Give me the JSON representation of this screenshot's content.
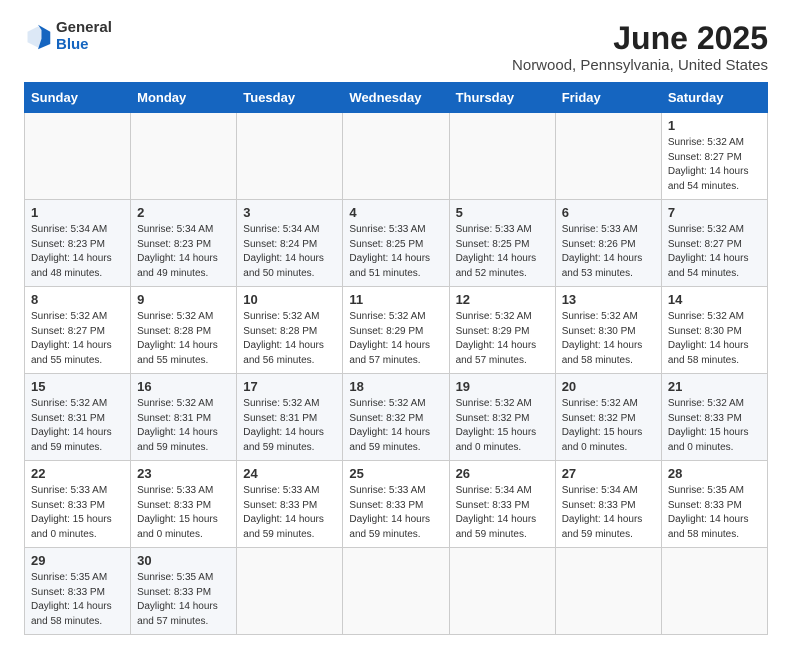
{
  "header": {
    "logo_general": "General",
    "logo_blue": "Blue",
    "month_title": "June 2025",
    "location": "Norwood, Pennsylvania, United States"
  },
  "calendar": {
    "days_of_week": [
      "Sunday",
      "Monday",
      "Tuesday",
      "Wednesday",
      "Thursday",
      "Friday",
      "Saturday"
    ],
    "weeks": [
      [
        {
          "day": "",
          "empty": true
        },
        {
          "day": "",
          "empty": true
        },
        {
          "day": "",
          "empty": true
        },
        {
          "day": "",
          "empty": true
        },
        {
          "day": "",
          "empty": true
        },
        {
          "day": "",
          "empty": true
        },
        {
          "day": "1",
          "sunrise": "5:32 AM",
          "sunset": "8:27 PM",
          "daylight": "14 hours and 54 minutes."
        }
      ],
      [
        {
          "day": "1",
          "sunrise": "5:34 AM",
          "sunset": "8:23 PM",
          "daylight": "14 hours and 48 minutes."
        },
        {
          "day": "2",
          "sunrise": "5:34 AM",
          "sunset": "8:23 PM",
          "daylight": "14 hours and 49 minutes."
        },
        {
          "day": "3",
          "sunrise": "5:34 AM",
          "sunset": "8:24 PM",
          "daylight": "14 hours and 50 minutes."
        },
        {
          "day": "4",
          "sunrise": "5:33 AM",
          "sunset": "8:25 PM",
          "daylight": "14 hours and 51 minutes."
        },
        {
          "day": "5",
          "sunrise": "5:33 AM",
          "sunset": "8:25 PM",
          "daylight": "14 hours and 52 minutes."
        },
        {
          "day": "6",
          "sunrise": "5:33 AM",
          "sunset": "8:26 PM",
          "daylight": "14 hours and 53 minutes."
        },
        {
          "day": "7",
          "sunrise": "5:32 AM",
          "sunset": "8:27 PM",
          "daylight": "14 hours and 54 minutes."
        }
      ],
      [
        {
          "day": "8",
          "sunrise": "5:32 AM",
          "sunset": "8:27 PM",
          "daylight": "14 hours and 55 minutes."
        },
        {
          "day": "9",
          "sunrise": "5:32 AM",
          "sunset": "8:28 PM",
          "daylight": "14 hours and 55 minutes."
        },
        {
          "day": "10",
          "sunrise": "5:32 AM",
          "sunset": "8:28 PM",
          "daylight": "14 hours and 56 minutes."
        },
        {
          "day": "11",
          "sunrise": "5:32 AM",
          "sunset": "8:29 PM",
          "daylight": "14 hours and 57 minutes."
        },
        {
          "day": "12",
          "sunrise": "5:32 AM",
          "sunset": "8:29 PM",
          "daylight": "14 hours and 57 minutes."
        },
        {
          "day": "13",
          "sunrise": "5:32 AM",
          "sunset": "8:30 PM",
          "daylight": "14 hours and 58 minutes."
        },
        {
          "day": "14",
          "sunrise": "5:32 AM",
          "sunset": "8:30 PM",
          "daylight": "14 hours and 58 minutes."
        }
      ],
      [
        {
          "day": "15",
          "sunrise": "5:32 AM",
          "sunset": "8:31 PM",
          "daylight": "14 hours and 59 minutes."
        },
        {
          "day": "16",
          "sunrise": "5:32 AM",
          "sunset": "8:31 PM",
          "daylight": "14 hours and 59 minutes."
        },
        {
          "day": "17",
          "sunrise": "5:32 AM",
          "sunset": "8:31 PM",
          "daylight": "14 hours and 59 minutes."
        },
        {
          "day": "18",
          "sunrise": "5:32 AM",
          "sunset": "8:32 PM",
          "daylight": "14 hours and 59 minutes."
        },
        {
          "day": "19",
          "sunrise": "5:32 AM",
          "sunset": "8:32 PM",
          "daylight": "15 hours and 0 minutes."
        },
        {
          "day": "20",
          "sunrise": "5:32 AM",
          "sunset": "8:32 PM",
          "daylight": "15 hours and 0 minutes."
        },
        {
          "day": "21",
          "sunrise": "5:32 AM",
          "sunset": "8:33 PM",
          "daylight": "15 hours and 0 minutes."
        }
      ],
      [
        {
          "day": "22",
          "sunrise": "5:33 AM",
          "sunset": "8:33 PM",
          "daylight": "15 hours and 0 minutes."
        },
        {
          "day": "23",
          "sunrise": "5:33 AM",
          "sunset": "8:33 PM",
          "daylight": "15 hours and 0 minutes."
        },
        {
          "day": "24",
          "sunrise": "5:33 AM",
          "sunset": "8:33 PM",
          "daylight": "14 hours and 59 minutes."
        },
        {
          "day": "25",
          "sunrise": "5:33 AM",
          "sunset": "8:33 PM",
          "daylight": "14 hours and 59 minutes."
        },
        {
          "day": "26",
          "sunrise": "5:34 AM",
          "sunset": "8:33 PM",
          "daylight": "14 hours and 59 minutes."
        },
        {
          "day": "27",
          "sunrise": "5:34 AM",
          "sunset": "8:33 PM",
          "daylight": "14 hours and 59 minutes."
        },
        {
          "day": "28",
          "sunrise": "5:35 AM",
          "sunset": "8:33 PM",
          "daylight": "14 hours and 58 minutes."
        }
      ],
      [
        {
          "day": "29",
          "sunrise": "5:35 AM",
          "sunset": "8:33 PM",
          "daylight": "14 hours and 58 minutes."
        },
        {
          "day": "30",
          "sunrise": "5:35 AM",
          "sunset": "8:33 PM",
          "daylight": "14 hours and 57 minutes."
        },
        {
          "day": "",
          "empty": true
        },
        {
          "day": "",
          "empty": true
        },
        {
          "day": "",
          "empty": true
        },
        {
          "day": "",
          "empty": true
        },
        {
          "day": "",
          "empty": true
        }
      ]
    ]
  }
}
